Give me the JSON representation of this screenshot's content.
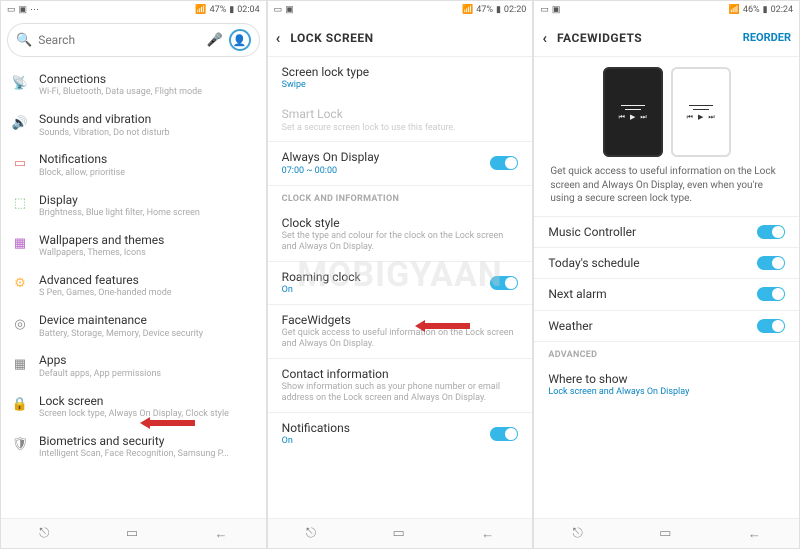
{
  "screen1": {
    "status": {
      "battery": "47%",
      "time": "02:04",
      "signal": "⫶"
    },
    "search_placeholder": "Search",
    "items": [
      {
        "icon": "connections",
        "title": "Connections",
        "sub": "Wi-Fi, Bluetooth, Data usage, Flight mode"
      },
      {
        "icon": "sound",
        "title": "Sounds and vibration",
        "sub": "Sounds, Vibration, Do not disturb"
      },
      {
        "icon": "notif",
        "title": "Notifications",
        "sub": "Block, allow, prioritise"
      },
      {
        "icon": "display",
        "title": "Display",
        "sub": "Brightness, Blue light filter, Home screen"
      },
      {
        "icon": "wallpaper",
        "title": "Wallpapers and themes",
        "sub": "Wallpapers, Themes, Icons"
      },
      {
        "icon": "advanced",
        "title": "Advanced features",
        "sub": "S Pen, Games, One-handed mode"
      },
      {
        "icon": "maint",
        "title": "Device maintenance",
        "sub": "Battery, Storage, Memory, Device security"
      },
      {
        "icon": "apps",
        "title": "Apps",
        "sub": "Default apps, App permissions"
      },
      {
        "icon": "lock",
        "title": "Lock screen",
        "sub": "Screen lock type, Always On Display, Clock style"
      },
      {
        "icon": "bio",
        "title": "Biometrics and security",
        "sub": "Intelligent Scan, Face Recognition, Samsung P..."
      }
    ]
  },
  "screen2": {
    "status": {
      "battery": "47%",
      "time": "02:20"
    },
    "title": "LOCK SCREEN",
    "lock_type_title": "Screen lock type",
    "lock_type_sub": "Swipe",
    "smartlock_title": "Smart Lock",
    "smartlock_sub": "Set a secure screen lock to use this feature.",
    "aod_title": "Always On Display",
    "aod_sub": "07:00 ~ 00:00",
    "section_clock": "CLOCK AND INFORMATION",
    "clockstyle_title": "Clock style",
    "clockstyle_sub": "Set the type and colour for the clock on the Lock screen and Always On Display.",
    "roaming_title": "Roaming clock",
    "roaming_sub": "On",
    "fw_title": "FaceWidgets",
    "fw_sub": "Get quick access to useful information on the Lock screen and Always On Display.",
    "contact_title": "Contact information",
    "contact_sub": "Show information such as your phone number or email address on the Lock screen and Always On Display.",
    "notif_title": "Notifications",
    "notif_sub": "On"
  },
  "screen3": {
    "status": {
      "battery": "46%",
      "time": "02:24"
    },
    "title": "FACEWIDGETS",
    "reorder": "REORDER",
    "preview_text": "Get quick access to useful information on the Lock screen and Always On Display, even when you're using a secure screen lock type.",
    "music": "Music Controller",
    "schedule": "Today's schedule",
    "alarm": "Next alarm",
    "weather": "Weather",
    "section_adv": "ADVANCED",
    "where_title": "Where to show",
    "where_sub": "Lock screen and Always On Display"
  },
  "watermark": "MOBIGYAAN"
}
